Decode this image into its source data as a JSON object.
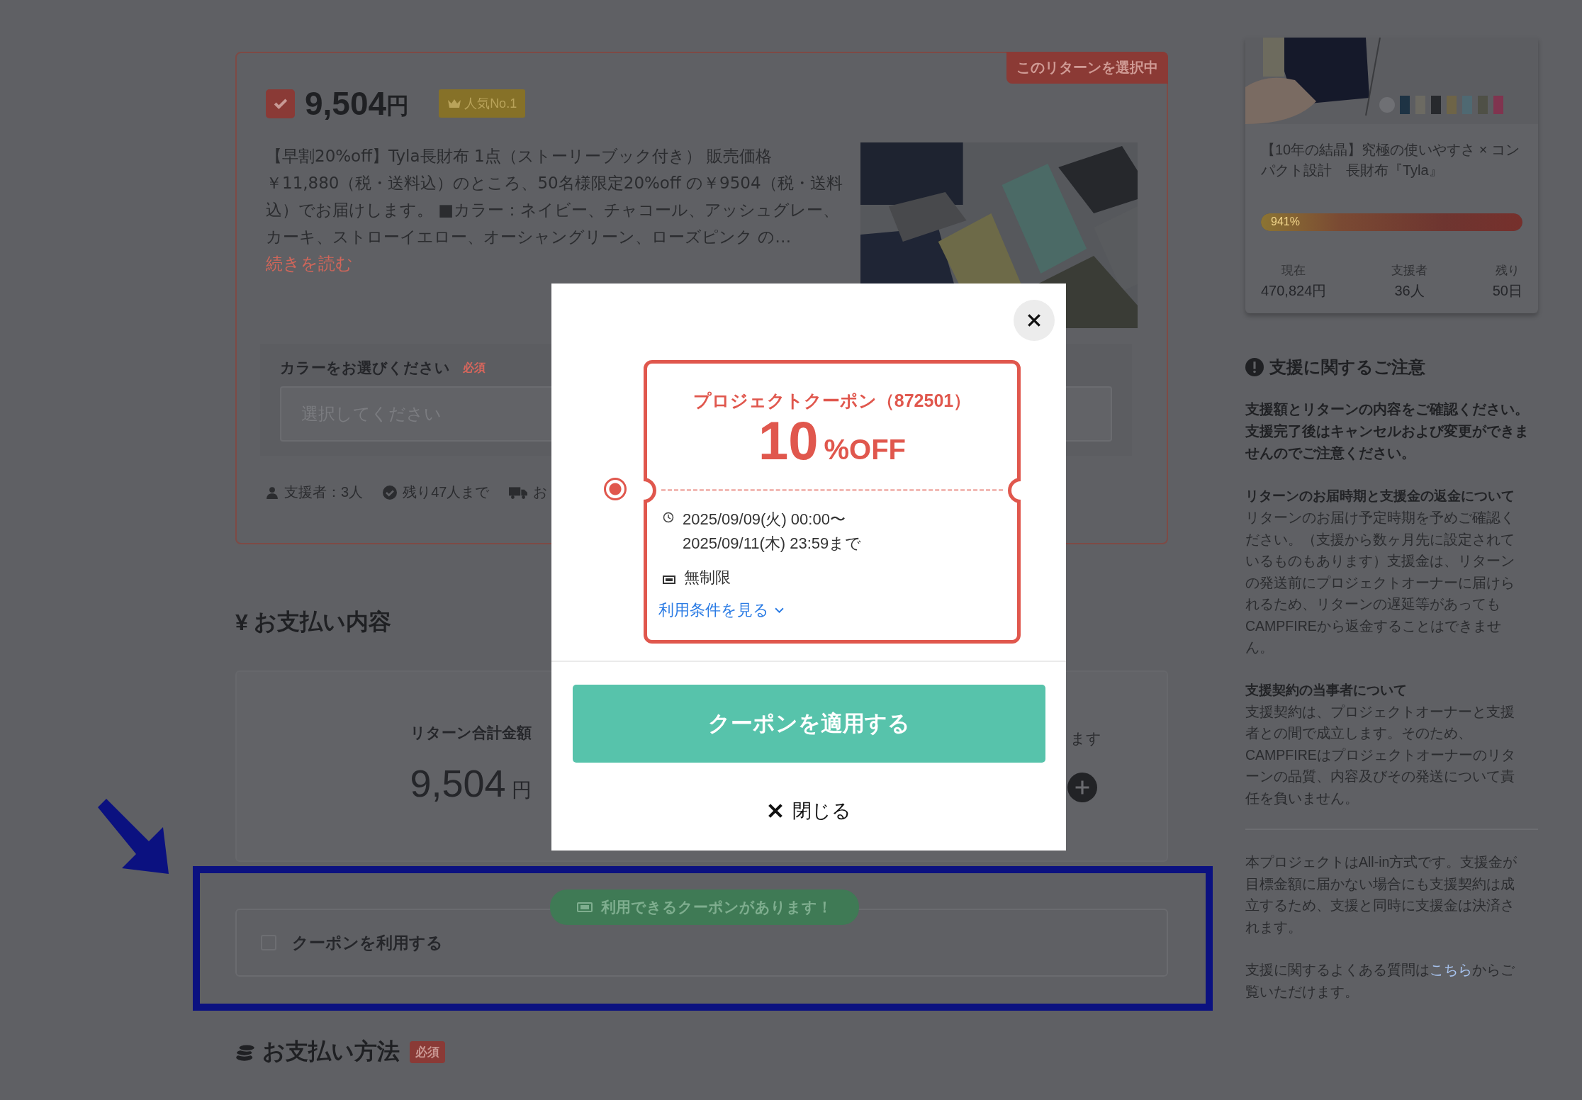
{
  "reward_card": {
    "status_badge": "このリターンを選択中",
    "checked": true,
    "price": "9,504",
    "currency": "円",
    "badge": "人気No.1",
    "description": "【早割20%off】Tyla長財布 1点（ストーリーブック付き） 販売価格￥11,880（税・送料込）のところ、50名様限定20%off の￥9504（税・送料込）でお届けします。 ■カラー：ネイビー、チャコール、アッシュグレー、カーキ、ストローイエロー、オーシャングリーン、ローズピンク の…",
    "read_more": "続きを読む",
    "option": {
      "label": "カラーをお選びください",
      "required": "必須",
      "placeholder": "選択してください"
    },
    "stats": [
      {
        "kind": "person",
        "text": "支援者：3人"
      },
      {
        "kind": "check",
        "text": "残り47人まで"
      },
      {
        "kind": "truck",
        "text": "お"
      }
    ]
  },
  "payment_summary": {
    "currency_sign": "¥",
    "title": "お支払い内容",
    "total_label": "リターン合計金額",
    "total_amount": "9,504",
    "total_unit": "円",
    "column_2_text": "ます"
  },
  "coupon_box": {
    "badge": "利用できるクーポンがあります！",
    "checked": false,
    "label": "クーポンを利用する"
  },
  "payment_method": {
    "title": "お支払い方法",
    "required": "必須"
  },
  "sidebar": {
    "project_title": "【10年の結晶】究極の使いやすさ × コンパクト設計　長財布『Tyla』",
    "progress": {
      "level": 1,
      "label": "941%"
    },
    "stats": [
      {
        "label": "現在",
        "value": "470,824円"
      },
      {
        "label": "支援者",
        "value": "36人"
      },
      {
        "label": "残り",
        "value": "50日"
      }
    ],
    "notice_title": "支援に関するご注意",
    "notice_lead": "支援額とリターンの内容をご確認ください。支援完了後はキャンセルおよび変更ができませんのでご注意ください。",
    "sections": [
      {
        "heading": "リターンのお届時期と支援金の返金について",
        "body": "リターンのお届け予定時期を予めご確認ください。（支援から数ヶ月先に設定されているものもあります）支援金は、リターンの発送前にプロジェクトオーナーに届けられるため、リターンの遅延等があってもCAMPFIREから返金することはできません。"
      },
      {
        "heading": "支援契約の当事者について",
        "body": "支援契約は、プロジェクトオーナーと支援者との間で成立します。そのため、CAMPFIREはプロジェクトオーナーのリターンの品質、内容及びその発送について責任を負いません。"
      }
    ],
    "all_in_note": "本プロジェクトはAll-in方式です。支援金が目標金額に届かない場合にも支援契約は成立するため、支援と同時に支援金は決済されます。",
    "faq": {
      "before": "支援に関するよくある質問は",
      "link": "こちら",
      "after": "からご覧いただけます。"
    }
  },
  "modal": {
    "coupon": {
      "selected": true,
      "title": "プロジェクトクーポン（872501）",
      "amount": "10",
      "unit": "%OFF",
      "period_start": "2025/09/09(火) 00:00〜",
      "period_end": "2025/09/11(木) 23:59まで",
      "usage_limit": "無制限",
      "terms_link": "利用条件を見る"
    },
    "apply_button": "クーポンを適用する",
    "close_button": "閉じる"
  }
}
